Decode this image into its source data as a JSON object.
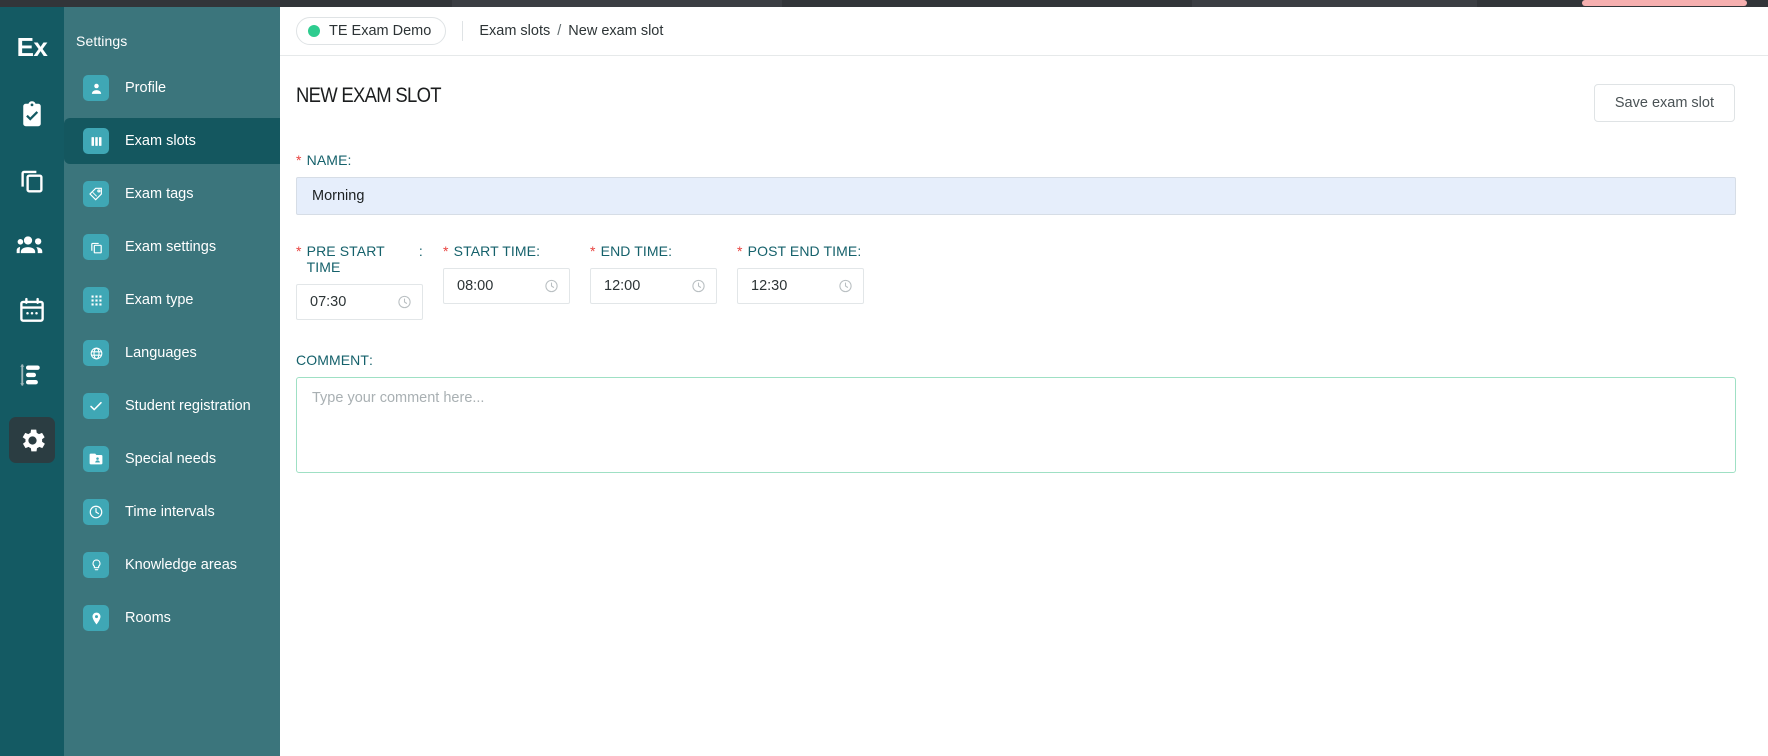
{
  "brand": {
    "logo_text": "Ex"
  },
  "icon_rail": {
    "items": [
      {
        "name": "exams",
        "icon": "clipboard-check-icon",
        "active": false
      },
      {
        "name": "copies",
        "icon": "copy-icon",
        "active": false
      },
      {
        "name": "students",
        "icon": "people-icon",
        "active": false
      },
      {
        "name": "calendar",
        "icon": "calendar-icon",
        "active": false
      },
      {
        "name": "planning",
        "icon": "sliders-icon",
        "active": false
      },
      {
        "name": "settings",
        "icon": "gear-icon",
        "active": true
      }
    ]
  },
  "sidebar": {
    "title": "Settings",
    "items": [
      {
        "label": "Profile",
        "icon": "person-icon",
        "active": false
      },
      {
        "label": "Exam slots",
        "icon": "columns-icon",
        "active": true
      },
      {
        "label": "Exam tags",
        "icon": "tag-icon",
        "active": false
      },
      {
        "label": "Exam settings",
        "icon": "copy-icon",
        "active": false
      },
      {
        "label": "Exam type",
        "icon": "grid-icon",
        "active": false
      },
      {
        "label": "Languages",
        "icon": "globe-icon",
        "active": false
      },
      {
        "label": "Student registration",
        "icon": "check-icon",
        "active": false
      },
      {
        "label": "Special needs",
        "icon": "id-card-icon",
        "active": false
      },
      {
        "label": "Time intervals",
        "icon": "clock-icon",
        "active": false
      },
      {
        "label": "Knowledge areas",
        "icon": "lightbulb-icon",
        "active": false
      },
      {
        "label": "Rooms",
        "icon": "location-pin-icon",
        "active": false
      }
    ]
  },
  "breadcrumb": {
    "workspace": "TE Exam Demo",
    "workspace_status_color": "#2ecc8f",
    "parent": "Exam slots",
    "separator": "/",
    "current": "New exam slot"
  },
  "page": {
    "title": "NEW EXAM SLOT",
    "save_label": "Save exam slot"
  },
  "form": {
    "name": {
      "label": "NAME",
      "required_marker": "*",
      "colon": ":",
      "value": "Morning"
    },
    "pre_start_time": {
      "label": "PRE START TIME",
      "required_marker": "*",
      "colon": ":",
      "value": "07:30"
    },
    "start_time": {
      "label": "START TIME",
      "required_marker": "*",
      "colon": ":",
      "value": "08:00"
    },
    "end_time": {
      "label": "END TIME",
      "required_marker": "*",
      "colon": ":",
      "value": "12:00"
    },
    "post_end_time": {
      "label": "POST END TIME",
      "required_marker": "*",
      "colon": ":",
      "value": "12:30"
    },
    "comment": {
      "label": "COMMENT",
      "colon": ":",
      "value": "",
      "placeholder": "Type your comment here..."
    }
  },
  "colors": {
    "rail": "#145a63",
    "sidebar": "#3b757c",
    "sidebar_active": "#14575f",
    "nav_icon": "#3fa7b5",
    "label_teal": "#15616b",
    "required_red": "#e8433f",
    "autofill_blue": "#e6eefb",
    "comment_border": "#9fe0c4"
  }
}
